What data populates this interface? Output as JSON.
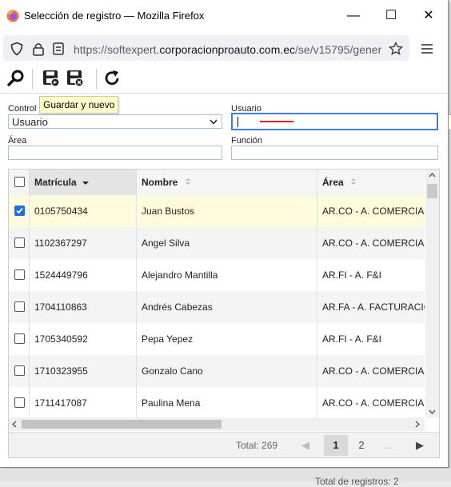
{
  "window": {
    "title": "Selección de registro — Mozilla Firefox",
    "url_prefix": "https://softexpert.",
    "url_domain": "corporacionproauto.com.ec",
    "url_suffix": "/se/v15795/gener"
  },
  "tooltip": "Guardar y nuevo",
  "filters": {
    "control_label": "Control",
    "control_value": "Usuario",
    "usuario_label": "Usuario",
    "usuario_value": "",
    "area_label": "Área",
    "area_value": "",
    "funcion_label": "Función",
    "funcion_value": ""
  },
  "grid": {
    "columns": [
      "Matrícula",
      "Nombre",
      "Área"
    ],
    "rows": [
      {
        "matricula": "0105750434",
        "nombre": "Juan Bustos",
        "area": "AR.CO - A. COMERCIAL",
        "checked": true
      },
      {
        "matricula": "1102367297",
        "nombre": "Angel Silva",
        "area": "AR.CO - A. COMERCIAL",
        "checked": false
      },
      {
        "matricula": "1524449796",
        "nombre": "Alejandro Mantilla",
        "area": "AR.FI - A. F&I",
        "checked": false
      },
      {
        "matricula": "1704110863",
        "nombre": "Andrés Cabezas",
        "area": "AR.FA - A. FACTURACIÓ",
        "checked": false
      },
      {
        "matricula": "1705340592",
        "nombre": "Pepa Yepez",
        "area": "AR.FI - A. F&I",
        "checked": false
      },
      {
        "matricula": "1710323955",
        "nombre": "Gonzalo Cano",
        "area": "AR.CO - A. COMERCIAL",
        "checked": false
      },
      {
        "matricula": "1711417087",
        "nombre": "Paulina Mena",
        "area": "AR.CO - A. COMERCIAL",
        "checked": false
      }
    ]
  },
  "pagination": {
    "total": "Total: 269",
    "page1": "1",
    "page2": "2",
    "ellipsis": "..."
  },
  "status": {
    "total_registros": "Total de registros: 2"
  },
  "colors": {
    "selected_row": "#fdfbdc",
    "accent": "#1e6fd9",
    "tooltip_bg": "#ffffcc"
  }
}
